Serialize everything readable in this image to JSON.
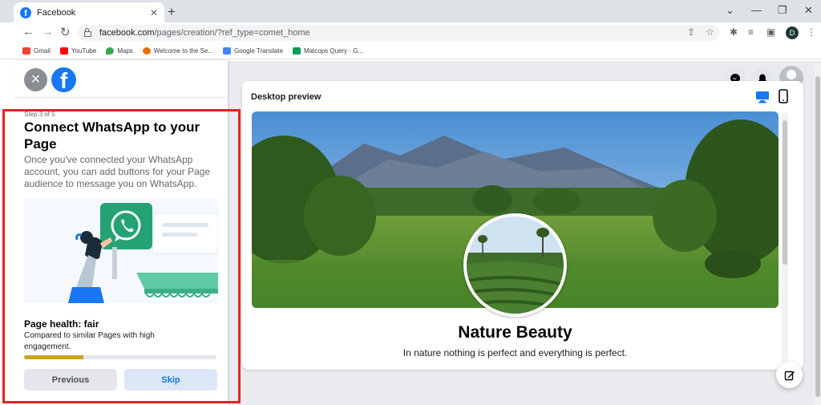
{
  "browser": {
    "tab_title": "Facebook",
    "url_host": "facebook.com",
    "url_path": "/pages/creation/?ref_type=comet_home",
    "profile_initial": "D",
    "bookmarks": [
      {
        "label": "Gmail",
        "color": "#ea4335"
      },
      {
        "label": "YouTube",
        "color": "#ff0000"
      },
      {
        "label": "Maps",
        "color": "#34a853"
      },
      {
        "label": "Welcome to the Se...",
        "color": "#e8710a"
      },
      {
        "label": "Google Translate",
        "color": "#4285f4"
      },
      {
        "label": "Matcops Query - G...",
        "color": "#0f9d58"
      }
    ]
  },
  "wizard": {
    "step": "Step 3 of 5",
    "heading": "Connect WhatsApp to your Page",
    "description": "Once you've connected your WhatsApp account, you can add buttons for your Page audience to message you on WhatsApp.",
    "health_title": "Page health: fair",
    "health_sub": "Compared to similar Pages with high engagement.",
    "health_progress": 0.31,
    "previous_label": "Previous",
    "skip_label": "Skip"
  },
  "preview": {
    "label": "Desktop preview",
    "page_name": "Nature Beauty",
    "tagline": "In nature nothing is perfect and everything is perfect."
  },
  "colors": {
    "facebook_blue": "#1877f2",
    "whatsapp_green": "#25a274",
    "highlight_red": "#e02424",
    "health_fill": "#c9a227"
  }
}
